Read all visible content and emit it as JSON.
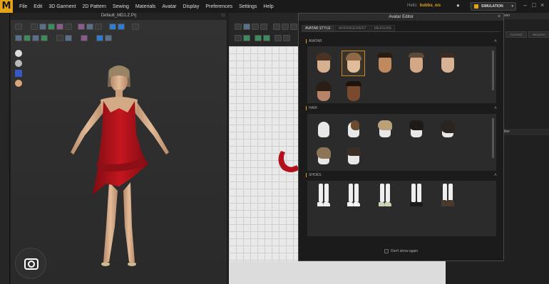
{
  "app": {
    "logo": "M",
    "menu": [
      "File",
      "Edit",
      "3D Garment",
      "2D Pattern",
      "Sewing",
      "Materials",
      "Avatar",
      "Display",
      "Preferences",
      "Settings",
      "Help"
    ],
    "user_label": "Hello",
    "user_name": "bubbs_ws",
    "mode_button": "SIMULATION"
  },
  "viewport3d": {
    "title": "Default_MD1.Z.Prj"
  },
  "avatar_editor": {
    "title": "Avatar Editor",
    "tabs": [
      {
        "label": "AVATAR STYLE",
        "active": true
      },
      {
        "label": "ARRANGEMENT",
        "active": false
      },
      {
        "label": "MEASURE",
        "active": false
      }
    ],
    "sections": {
      "avatar": {
        "label": "AVATAR",
        "count": 7,
        "selected_index": 1
      },
      "hair": {
        "label": "HAIR",
        "count": 7
      },
      "shoes": {
        "label": "SHOES",
        "count": 5
      }
    },
    "dont_show_label": "Don't show again"
  },
  "right_panel": {
    "tab_label": "ilter",
    "top_label": "ster",
    "btn1": "CLOSING",
    "btn2": "WEAVING"
  },
  "colors": {
    "accent": "#e3a21a",
    "dress": "#b3121c",
    "grid_bg": "#e9e9e9"
  }
}
